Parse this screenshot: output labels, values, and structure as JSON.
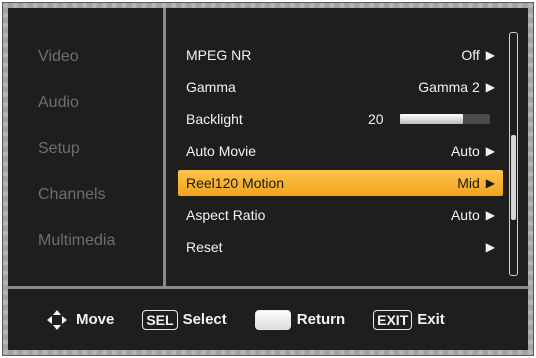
{
  "sidebar": {
    "items": [
      {
        "label": "Video",
        "active": true
      },
      {
        "label": "Audio",
        "active": false
      },
      {
        "label": "Setup",
        "active": false
      },
      {
        "label": "Channels",
        "active": false
      },
      {
        "label": "Multimedia",
        "active": false
      }
    ]
  },
  "menu": {
    "rows": [
      {
        "label": "MPEG NR",
        "value": "Off"
      },
      {
        "label": "Gamma",
        "value": "Gamma 2"
      },
      {
        "label": "Backlight",
        "value": "20"
      },
      {
        "label": "Auto Movie",
        "value": "Auto"
      },
      {
        "label": "Reel120 Motion",
        "value": "Mid"
      },
      {
        "label": "Aspect Ratio",
        "value": "Auto"
      },
      {
        "label": "Reset",
        "value": ""
      }
    ],
    "backlight_level": 0.7,
    "selected_index": 4,
    "arrow_glyph": "▶"
  },
  "scroll": {
    "position_fraction": 0.65,
    "visible_fraction": 0.35
  },
  "footer": {
    "move_label": "Move",
    "sel_key": "SEL",
    "select_label": "Select",
    "return_label": "Return",
    "exit_key": "EXIT",
    "exit_label": "Exit"
  },
  "colors": {
    "accent": "#f5a623",
    "background": "#1e1e1e",
    "inactive_text": "#6e6e6e"
  }
}
